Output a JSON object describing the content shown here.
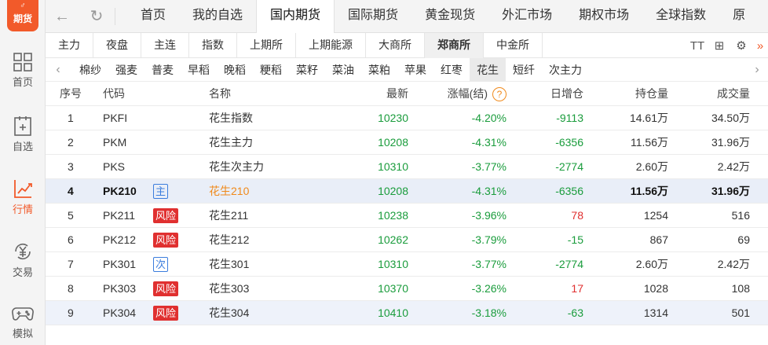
{
  "logo": {
    "text": "期货",
    "mark": "♂"
  },
  "sidebar": {
    "items": [
      {
        "label": "首页",
        "icon": "grid-icon"
      },
      {
        "label": "自选",
        "icon": "watchlist-icon"
      },
      {
        "label": "行情",
        "icon": "chart-icon",
        "active": true
      },
      {
        "label": "交易",
        "icon": "yuan-icon"
      },
      {
        "label": "模拟",
        "icon": "gamepad-icon"
      }
    ]
  },
  "topnav": {
    "back": "←",
    "refresh": "↻",
    "tabs": [
      "首页",
      "我的自选",
      "国内期货",
      "国际期货",
      "黄金现货",
      "外汇市场",
      "期权市场",
      "全球指数",
      "原"
    ]
  },
  "exchange_tabs": [
    "主力",
    "夜盘",
    "主连",
    "指数",
    "上期所",
    "上期能源",
    "大商所",
    "郑商所",
    "中金所"
  ],
  "tools": {
    "font": "TT",
    "layout": "⊞",
    "settings": "⚙",
    "more": "»"
  },
  "products": {
    "left_arrow": "‹",
    "right_arrow": "›",
    "items": [
      "棉纱",
      "强麦",
      "普麦",
      "早稻",
      "晚稻",
      "粳稻",
      "菜籽",
      "菜油",
      "菜粕",
      "苹果",
      "红枣",
      "花生",
      "短纤",
      "次主力"
    ]
  },
  "table": {
    "headers": {
      "idx": "序号",
      "code": "代码",
      "name": "名称",
      "last": "最新",
      "chg": "涨幅(结)",
      "help": "?",
      "inc": "日增仓",
      "oi": "持仓量",
      "vol": "成交量"
    },
    "rows": [
      {
        "idx": "1",
        "code": "PKFI",
        "badge": "",
        "name": "花生指数",
        "last": "10230",
        "chg": "-4.20%",
        "inc": "-9113",
        "oi": "14.61万",
        "vol": "34.50万"
      },
      {
        "idx": "2",
        "code": "PKM",
        "badge": "",
        "name": "花生主力",
        "last": "10208",
        "chg": "-4.31%",
        "inc": "-6356",
        "oi": "11.56万",
        "vol": "31.96万"
      },
      {
        "idx": "3",
        "code": "PKS",
        "badge": "",
        "name": "花生次主力",
        "last": "10310",
        "chg": "-3.77%",
        "inc": "-2774",
        "oi": "2.60万",
        "vol": "2.42万"
      },
      {
        "idx": "4",
        "code": "PK210",
        "badge": "主",
        "name": "花生210",
        "last": "10208",
        "chg": "-4.31%",
        "inc": "-6356",
        "oi": "11.56万",
        "vol": "31.96万"
      },
      {
        "idx": "5",
        "code": "PK211",
        "badge": "风险",
        "name": "花生211",
        "last": "10238",
        "chg": "-3.96%",
        "inc": "78",
        "oi": "1254",
        "vol": "516"
      },
      {
        "idx": "6",
        "code": "PK212",
        "badge": "风险",
        "name": "花生212",
        "last": "10262",
        "chg": "-3.79%",
        "inc": "-15",
        "oi": "867",
        "vol": "69"
      },
      {
        "idx": "7",
        "code": "PK301",
        "badge": "次",
        "name": "花生301",
        "last": "10310",
        "chg": "-3.77%",
        "inc": "-2774",
        "oi": "2.60万",
        "vol": "2.42万"
      },
      {
        "idx": "8",
        "code": "PK303",
        "badge": "风险",
        "name": "花生303",
        "last": "10370",
        "chg": "-3.26%",
        "inc": "17",
        "oi": "1028",
        "vol": "108"
      },
      {
        "idx": "9",
        "code": "PK304",
        "badge": "风险",
        "name": "花生304",
        "last": "10410",
        "chg": "-3.18%",
        "inc": "-63",
        "oi": "1314",
        "vol": "501"
      }
    ]
  },
  "colors": {
    "accent": "#f25a2a",
    "down": "#1a9c3c",
    "up": "#e03030",
    "badge_blue": "#3b7ddd"
  }
}
